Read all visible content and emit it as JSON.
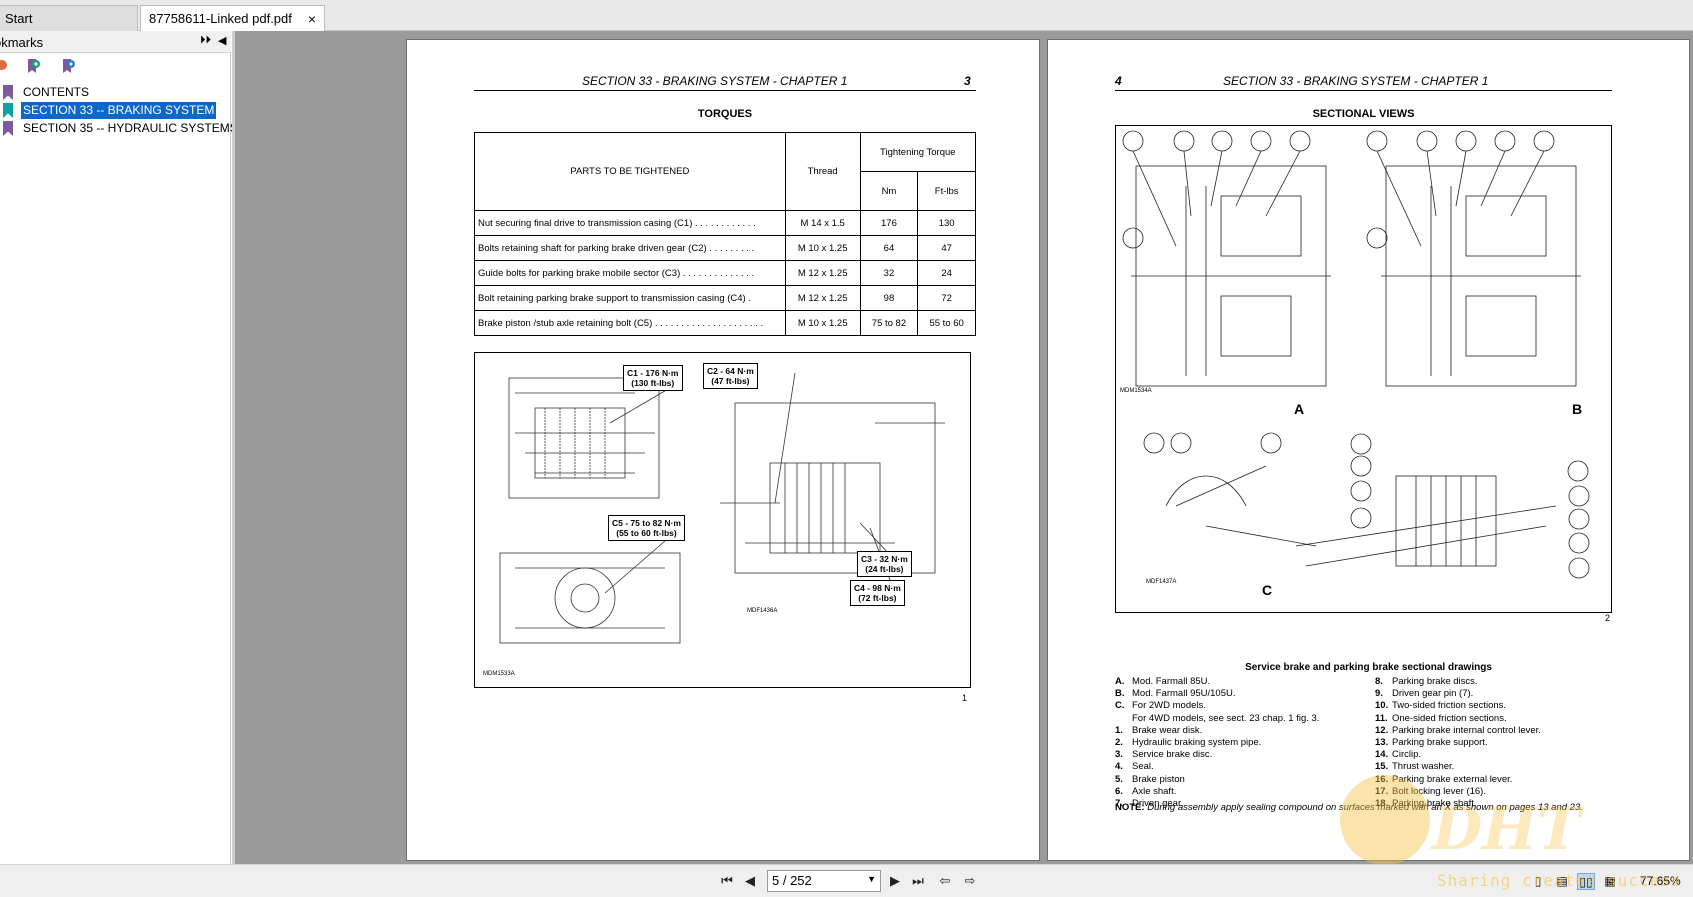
{
  "tabs": [
    {
      "label": "Start"
    },
    {
      "label": "87758611-Linked pdf.pdf",
      "close": "×"
    }
  ],
  "sidebar": {
    "title": "okmarks",
    "expand_icon": "⏵⏵",
    "collapse_icon": "◀",
    "items": [
      {
        "label": "CONTENTS"
      },
      {
        "label": "SECTION 33 -- BRAKING SYSTEM",
        "selected": true
      },
      {
        "label": "SECTION 35 -- HYDRAULIC SYSTEMS"
      }
    ]
  },
  "page3": {
    "header": "SECTION 33 - BRAKING SYSTEM - CHAPTER 1",
    "page_number": "3",
    "title": "TORQUES",
    "table": {
      "col_parts": "PARTS TO BE TIGHTENED",
      "col_thread": "Thread",
      "col_torque": "Tightening Torque",
      "col_nm": "Nm",
      "col_ftlbs": "Ft-lbs",
      "rows": [
        {
          "part": "Nut securing final drive to transmission casing (C1) . . . . . . . . . . . .",
          "thread": "M 14 x 1.5",
          "nm": "176",
          "ftlbs": "130"
        },
        {
          "part": "Bolts retaining shaft for parking brake driven gear (C2) . . . . . . . . .",
          "thread": "M 10 x 1.25",
          "nm": "64",
          "ftlbs": "47"
        },
        {
          "part": "Guide bolts for parking brake mobile sector (C3) . . . . . . . . . . . . . .",
          "thread": "M 12 x 1.25",
          "nm": "32",
          "ftlbs": "24"
        },
        {
          "part": "Bolt retaining parking brake support to transmission casing (C4) .",
          "thread": "M 12 x 1.25",
          "nm": "98",
          "ftlbs": "72"
        },
        {
          "part": "Brake piston /stub axle retaining bolt (C5) . . . . . . . . . . . . . . . . . . . . .",
          "thread": "M 10 x 1.25",
          "nm": "75 to 82",
          "ftlbs": "55 to 60"
        }
      ]
    },
    "callouts": [
      {
        "l1": "C1 - 176 N·m",
        "l2": "(130 ft-lbs)"
      },
      {
        "l1": "C2 - 64 N·m",
        "l2": "(47 ft-lbs)"
      },
      {
        "l1": "C5 - 75 to 82 N·m",
        "l2": "(55 to 60 ft-lbs)"
      },
      {
        "l1": "C3 - 32 N·m",
        "l2": "(24 ft-lbs)"
      },
      {
        "l1": "C4 - 98 N·m",
        "l2": "(72 ft-lbs)"
      }
    ],
    "fig_code_a": "MDM1533A",
    "fig_code_b": "MDF1436A",
    "fig_number": "1"
  },
  "page4": {
    "page_number": "4",
    "header": "SECTION 33 - BRAKING SYSTEM - CHAPTER 1",
    "title": "SECTIONAL VIEWS",
    "view_labels": [
      "A",
      "B",
      "C"
    ],
    "fig_code_a": "MDM1534A",
    "fig_code_c": "MDF1437A",
    "fig_number": "2",
    "caption": "Service brake and parking brake sectional drawings",
    "legend_left": [
      {
        "k": "A.",
        "v": "Mod. Farmall 85U."
      },
      {
        "k": "B.",
        "v": "Mod. Farmall 95U/105U."
      },
      {
        "k": "C.",
        "v": "For 2WD models."
      },
      {
        "k": "",
        "v": "For 4WD models, see sect. 23 chap. 1 fig. 3."
      },
      {
        "k": "1.",
        "v": "Brake wear disk."
      },
      {
        "k": "2.",
        "v": "Hydraulic braking system pipe."
      },
      {
        "k": "3.",
        "v": "Service brake disc."
      },
      {
        "k": "4.",
        "v": "Seal."
      },
      {
        "k": "5.",
        "v": "Brake piston"
      },
      {
        "k": "6.",
        "v": "Axle shaft."
      },
      {
        "k": "7.",
        "v": "Driven gear."
      }
    ],
    "legend_right": [
      {
        "k": "8.",
        "v": "Parking brake discs."
      },
      {
        "k": "9.",
        "v": "Driven gear pin (7)."
      },
      {
        "k": "10.",
        "v": "Two-sided friction sections."
      },
      {
        "k": "11.",
        "v": "One-sided friction sections."
      },
      {
        "k": "12.",
        "v": "Parking brake internal control lever."
      },
      {
        "k": "13.",
        "v": "Parking brake support."
      },
      {
        "k": "14.",
        "v": "Circlip."
      },
      {
        "k": "15.",
        "v": "Thrust washer."
      },
      {
        "k": "16.",
        "v": "Parking brake external lever."
      },
      {
        "k": "17.",
        "v": "Bolt locking lever (16)."
      },
      {
        "k": "18.",
        "v": "Parking brake shaft."
      }
    ],
    "note_label": "NOTE:",
    "note_text": "During assembly apply sealing compound on surfaces marked with an X as shown on pages 13 and 23."
  },
  "toolbar": {
    "page_field": "5 / 252",
    "zoom": "77.65%"
  },
  "watermark": {
    "text": "DHT",
    "tagline": "Sharing creates success"
  },
  "colors": {
    "accent": "#0b67c8",
    "doc_background": "#9b9b9b",
    "bookmark_flag": "#7b5b9c"
  },
  "icons": [
    "close-icon",
    "expand-all-icon",
    "collapse-panel-icon",
    "bookmark-flag-icon",
    "first-page-icon",
    "prev-page-icon",
    "next-page-icon",
    "last-page-icon",
    "dropdown-arrow-icon"
  ]
}
